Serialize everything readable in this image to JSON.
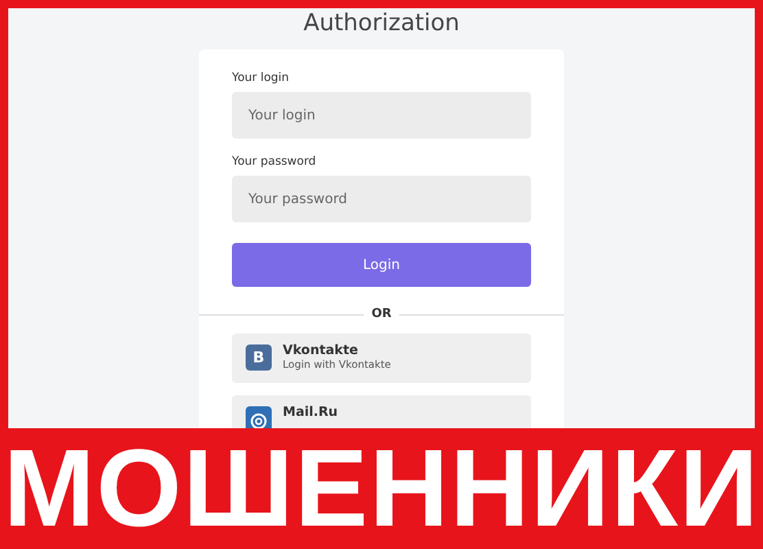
{
  "title": "Authorization",
  "form": {
    "fields": [
      {
        "label": "Your login",
        "placeholder": "Your login"
      },
      {
        "label": "Your password",
        "placeholder": "Your password"
      }
    ],
    "submit": "Login",
    "separator": "OR"
  },
  "social": [
    {
      "kind": "vk",
      "icon_text": "B",
      "title": "Vkontakte",
      "subtitle": "Login with Vkontakte"
    },
    {
      "kind": "mail",
      "title": "Mail.Ru"
    }
  ],
  "banner": "МОШЕННИКИ"
}
